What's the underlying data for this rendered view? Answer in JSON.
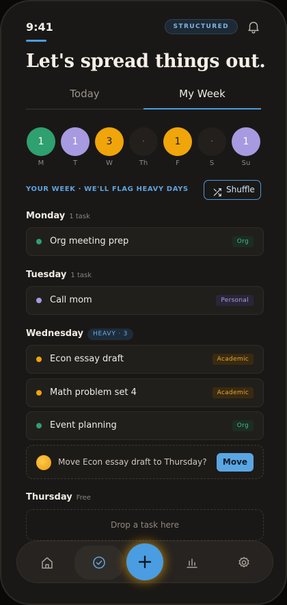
{
  "status": {
    "time": "9:41",
    "mode": "STRUCTURED"
  },
  "headline": "Let's spread things out.",
  "tabs": [
    {
      "label": "Today",
      "active": false
    },
    {
      "label": "My Week",
      "active": true
    }
  ],
  "week_days": [
    {
      "label": "M",
      "count": "1",
      "color": "green"
    },
    {
      "label": "T",
      "count": "1",
      "color": "purple"
    },
    {
      "label": "W",
      "count": "3",
      "color": "amber"
    },
    {
      "label": "Th",
      "count": "·",
      "color": "empty"
    },
    {
      "label": "F",
      "count": "1",
      "color": "amber"
    },
    {
      "label": "S",
      "count": "·",
      "color": "empty"
    },
    {
      "label": "Su",
      "count": "1",
      "color": "purple"
    }
  ],
  "week_caption": "YOUR WEEK · WE'LL FLAG HEAVY DAYS",
  "shuffle_label": "Shuffle",
  "groups": {
    "monday": {
      "day": "Monday",
      "meta": "1 task"
    },
    "tuesday": {
      "day": "Tuesday",
      "meta": "1 task"
    },
    "wednesday": {
      "day": "Wednesday",
      "heavy": "HEAVY · 3"
    },
    "thursday": {
      "day": "Thursday",
      "meta": "Free"
    }
  },
  "tasks": {
    "org_meeting": {
      "title": "Org meeting prep",
      "tag": "Org"
    },
    "call_mom": {
      "title": "Call mom",
      "tag": "Personal"
    },
    "econ_essay": {
      "title": "Econ essay draft",
      "tag": "Academic"
    },
    "math_set": {
      "title": "Math problem set 4",
      "tag": "Academic"
    },
    "event_planning": {
      "title": "Event planning",
      "tag": "Org"
    }
  },
  "suggestion": {
    "text": "Move Econ essay draft to Thursday?",
    "action": "Move"
  },
  "drop_zone": "Drop a task here",
  "colors": {
    "accent": "#4a9de0",
    "org": "#2fa070",
    "personal": "#a79ae0",
    "academic": "#f0a50a"
  },
  "nav": {
    "items": [
      "home-icon",
      "check-circle-icon",
      "plus-icon",
      "bar-chart-icon",
      "gear-icon"
    ],
    "active": "check-circle-icon"
  }
}
